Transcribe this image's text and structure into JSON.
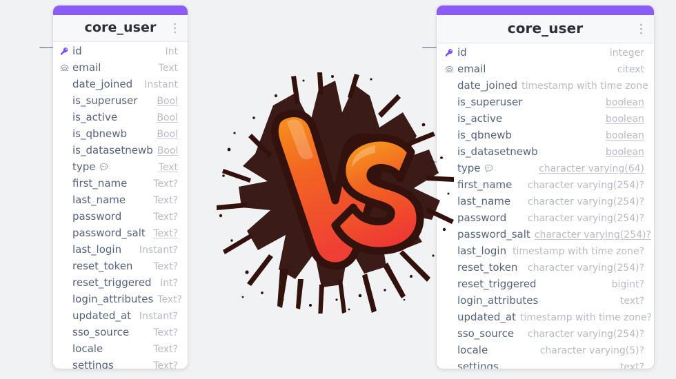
{
  "background_color": "#f1f2f4",
  "accent_color": "#8b5cf6",
  "center_graphic": {
    "name": "vs-graffiti-logo",
    "label": "VS",
    "colors": {
      "orange_light": "#f7931e",
      "orange": "#f26522",
      "red": "#ef3e36",
      "splatter_dark": "#3a1410"
    }
  },
  "panels": {
    "left": {
      "title": "core_user",
      "menu_icon": "kebab-menu-icon",
      "fields": [
        {
          "name": "id",
          "type": "Int",
          "required": false,
          "icon": "primary-key-icon",
          "note": false
        },
        {
          "name": "email",
          "type": "Text",
          "required": false,
          "icon": "unique-index-icon",
          "note": false
        },
        {
          "name": "date_joined",
          "type": "Instant",
          "required": false,
          "icon": null,
          "note": false
        },
        {
          "name": "is_superuser",
          "type": "Bool",
          "required": true,
          "icon": null,
          "note": false
        },
        {
          "name": "is_active",
          "type": "Bool",
          "required": true,
          "icon": null,
          "note": false
        },
        {
          "name": "is_qbnewb",
          "type": "Bool",
          "required": true,
          "icon": null,
          "note": false
        },
        {
          "name": "is_datasetnewb",
          "type": "Bool",
          "required": true,
          "icon": null,
          "note": false
        },
        {
          "name": "type",
          "type": "Text",
          "required": true,
          "icon": null,
          "note": true
        },
        {
          "name": "first_name",
          "type": "Text?",
          "required": false,
          "icon": null,
          "note": false
        },
        {
          "name": "last_name",
          "type": "Text?",
          "required": false,
          "icon": null,
          "note": false
        },
        {
          "name": "password",
          "type": "Text?",
          "required": false,
          "icon": null,
          "note": false
        },
        {
          "name": "password_salt",
          "type": "Text?",
          "required": true,
          "icon": null,
          "note": false
        },
        {
          "name": "last_login",
          "type": "Instant?",
          "required": false,
          "icon": null,
          "note": false
        },
        {
          "name": "reset_token",
          "type": "Text?",
          "required": false,
          "icon": null,
          "note": false
        },
        {
          "name": "reset_triggered",
          "type": "Int?",
          "required": false,
          "icon": null,
          "note": false
        },
        {
          "name": "login_attributes",
          "type": "Text?",
          "required": false,
          "icon": null,
          "note": false
        },
        {
          "name": "updated_at",
          "type": "Instant?",
          "required": false,
          "icon": null,
          "note": false
        },
        {
          "name": "sso_source",
          "type": "Text?",
          "required": false,
          "icon": null,
          "note": false
        },
        {
          "name": "locale",
          "type": "Text?",
          "required": false,
          "icon": null,
          "note": false
        },
        {
          "name": "settings",
          "type": "Text?",
          "required": false,
          "icon": null,
          "note": false
        }
      ]
    },
    "right": {
      "title": "core_user",
      "menu_icon": "kebab-menu-icon",
      "fields": [
        {
          "name": "id",
          "type": "integer",
          "required": false,
          "icon": "primary-key-icon",
          "note": false
        },
        {
          "name": "email",
          "type": "citext",
          "required": false,
          "icon": "unique-index-icon",
          "note": false
        },
        {
          "name": "date_joined",
          "type": "timestamp with time zone",
          "required": false,
          "icon": null,
          "note": false
        },
        {
          "name": "is_superuser",
          "type": "boolean",
          "required": true,
          "icon": null,
          "note": false
        },
        {
          "name": "is_active",
          "type": "boolean",
          "required": true,
          "icon": null,
          "note": false
        },
        {
          "name": "is_qbnewb",
          "type": "boolean",
          "required": true,
          "icon": null,
          "note": false
        },
        {
          "name": "is_datasetnewb",
          "type": "boolean",
          "required": true,
          "icon": null,
          "note": false
        },
        {
          "name": "type",
          "type": "character varying(64)",
          "required": true,
          "icon": null,
          "note": true
        },
        {
          "name": "first_name",
          "type": "character varying(254)?",
          "required": false,
          "icon": null,
          "note": false
        },
        {
          "name": "last_name",
          "type": "character varying(254)?",
          "required": false,
          "icon": null,
          "note": false
        },
        {
          "name": "password",
          "type": "character varying(254)?",
          "required": false,
          "icon": null,
          "note": false
        },
        {
          "name": "password_salt",
          "type": "character varying(254)?",
          "required": true,
          "icon": null,
          "note": false
        },
        {
          "name": "last_login",
          "type": "timestamp with time zone?",
          "required": false,
          "icon": null,
          "note": false
        },
        {
          "name": "reset_token",
          "type": "character varying(254)?",
          "required": false,
          "icon": null,
          "note": false
        },
        {
          "name": "reset_triggered",
          "type": "bigint?",
          "required": false,
          "icon": null,
          "note": false
        },
        {
          "name": "login_attributes",
          "type": "text?",
          "required": false,
          "icon": null,
          "note": false
        },
        {
          "name": "updated_at",
          "type": "timestamp with time zone?",
          "required": false,
          "icon": null,
          "note": false
        },
        {
          "name": "sso_source",
          "type": "character varying(254)?",
          "required": false,
          "icon": null,
          "note": false
        },
        {
          "name": "locale",
          "type": "character varying(5)?",
          "required": false,
          "icon": null,
          "note": false
        },
        {
          "name": "settings",
          "type": "text?",
          "required": false,
          "icon": null,
          "note": false
        }
      ]
    }
  }
}
